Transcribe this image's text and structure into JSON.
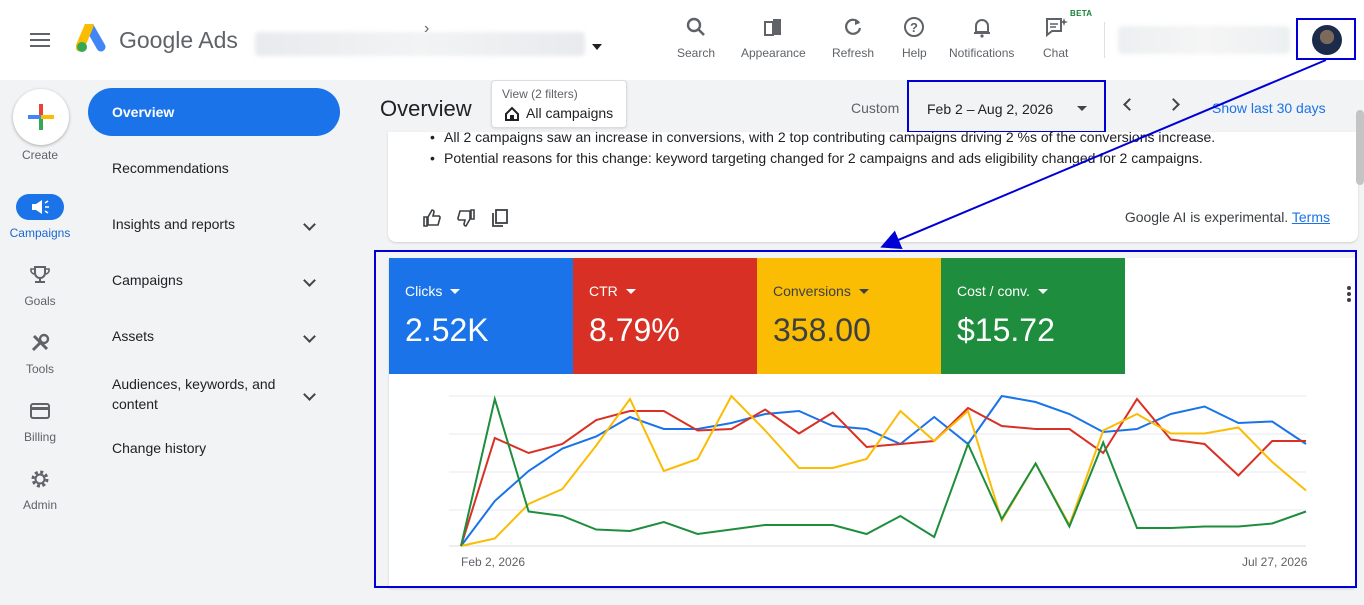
{
  "brand": {
    "name": "Google Ads"
  },
  "toolbar": {
    "search": "Search",
    "appearance": "Appearance",
    "refresh": "Refresh",
    "help": "Help",
    "notifications": "Notifications",
    "chat": "Chat",
    "beta": "BETA"
  },
  "rail": {
    "create": "Create",
    "campaigns": "Campaigns",
    "goals": "Goals",
    "tools": "Tools",
    "billing": "Billing",
    "admin": "Admin"
  },
  "nav": {
    "overview": "Overview",
    "recommendations": "Recommendations",
    "insights": "Insights and reports",
    "campaigns": "Campaigns",
    "assets": "Assets",
    "audiences_1": "Audiences, keywords, and",
    "audiences_2": "content",
    "history": "Change history"
  },
  "header": {
    "title": "Overview",
    "view_sub": "View (2 filters)",
    "view_main": "All campaigns",
    "custom": "Custom",
    "date_range": "Feb 2 – Aug 2, 2026",
    "show_last": "Show last 30 days"
  },
  "ai": {
    "line1": "All 2 campaigns saw an increase in conversions, with 2 top contributing campaigns driving 2 %s of the conversions increase.",
    "line2": "Potential reasons for this change: keyword targeting changed for 2 campaigns and ads eligibility changed for 2 campaigns.",
    "note": "Google AI is experimental.",
    "terms": "Terms"
  },
  "metrics": [
    {
      "label": "Clicks",
      "value": "2.52K",
      "color": "#1a73e8"
    },
    {
      "label": "CTR",
      "value": "8.79%",
      "color": "#d93025"
    },
    {
      "label": "Conversions",
      "value": "358.00",
      "color": "#fbbc04"
    },
    {
      "label": "Cost / conv.",
      "value": "$15.72",
      "color": "#1e8e3e"
    }
  ],
  "chart_data": {
    "type": "line",
    "x_start": "Feb 2, 2026",
    "x_end": "Jul 27, 2026",
    "ylim": [
      0,
      100
    ],
    "series": [
      {
        "name": "Clicks",
        "color": "#1a73e8",
        "values": [
          0,
          30,
          50,
          65,
          73,
          86,
          78,
          78,
          82,
          88,
          90,
          80,
          78,
          68,
          86,
          68,
          100,
          96,
          88,
          76,
          78,
          88,
          93,
          82,
          83,
          68
        ]
      },
      {
        "name": "CTR",
        "color": "#d93025",
        "values": [
          0,
          72,
          62,
          68,
          84,
          90,
          90,
          77,
          78,
          91,
          75,
          89,
          66,
          68,
          70,
          92,
          80,
          78,
          78,
          62,
          98,
          71,
          68,
          47,
          70,
          70
        ]
      },
      {
        "name": "Conversions",
        "color": "#fbbc04",
        "values": [
          0,
          5,
          28,
          38,
          67,
          98,
          50,
          58,
          100,
          77,
          52,
          52,
          58,
          90,
          70,
          90,
          17,
          55,
          14,
          77,
          88,
          75,
          75,
          79,
          56,
          37
        ]
      },
      {
        "name": "Cost / conv.",
        "color": "#1e8e3e",
        "values": [
          0,
          98,
          23,
          20,
          11,
          10,
          16,
          8,
          11,
          14,
          14,
          14,
          8,
          20,
          6,
          68,
          18,
          55,
          13,
          69,
          12,
          12,
          13,
          13,
          15,
          23
        ]
      }
    ]
  }
}
